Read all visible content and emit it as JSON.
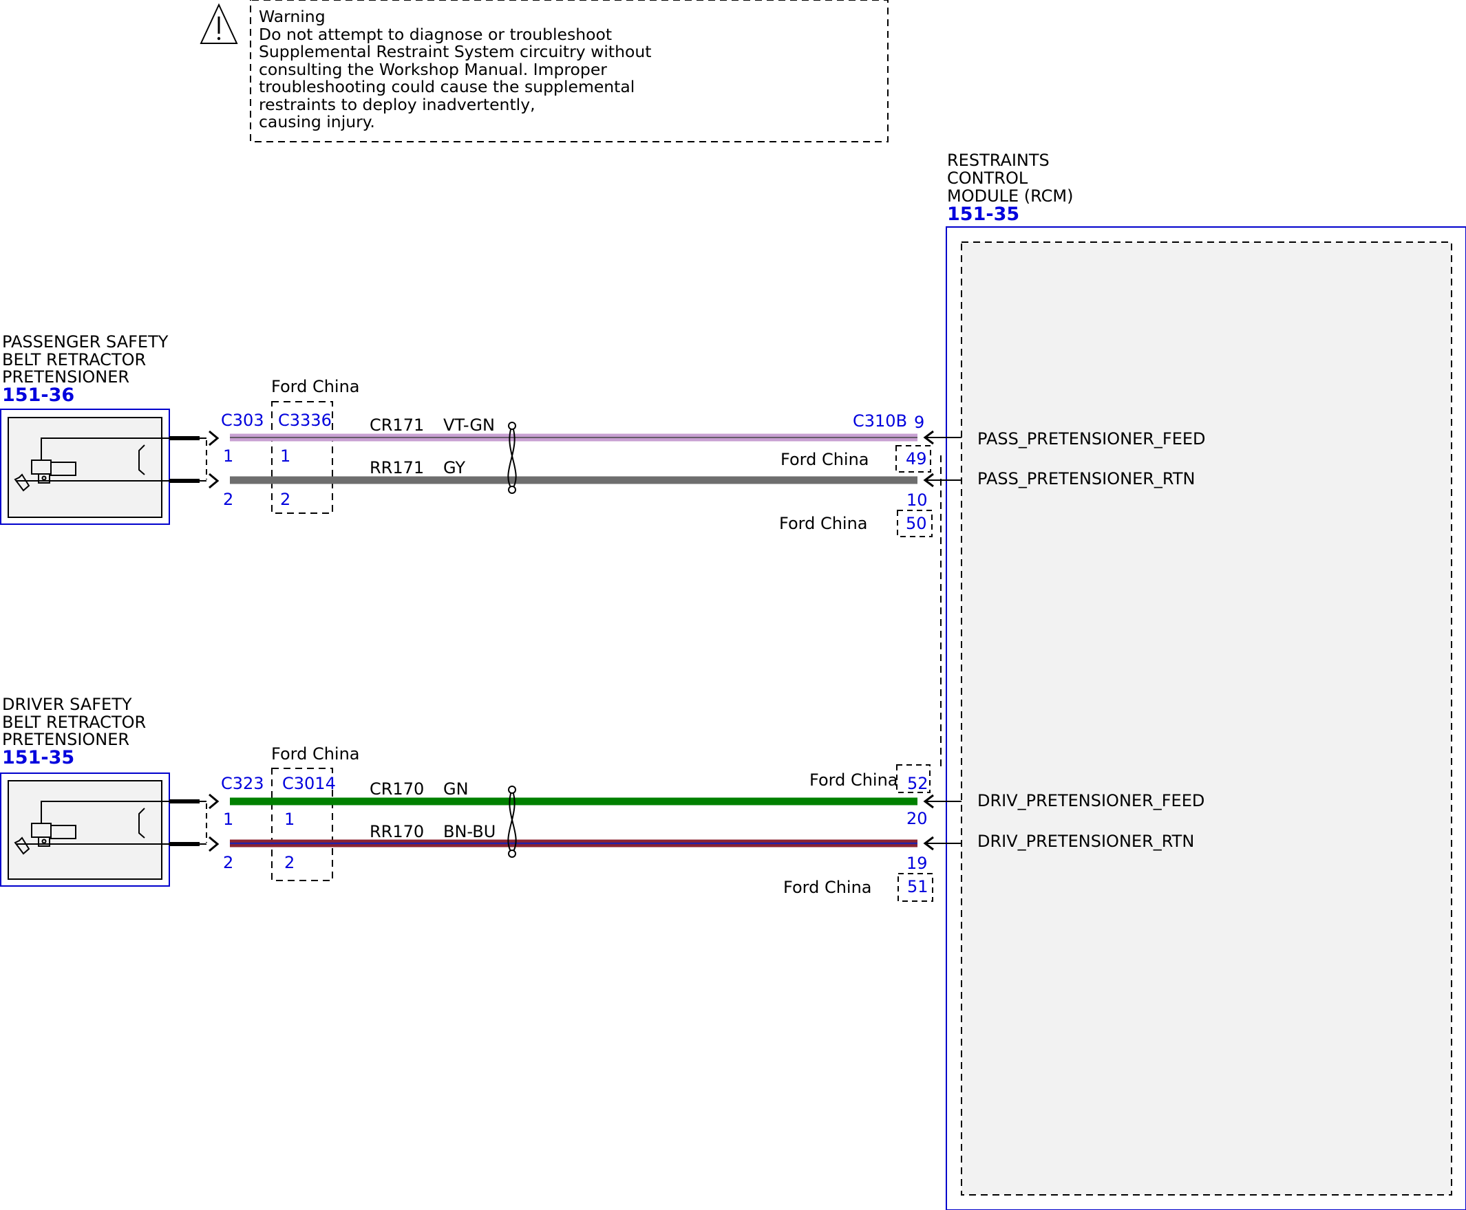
{
  "warning": {
    "title": "Warning",
    "lines": [
      "Do not attempt to diagnose or troubleshoot",
      "Supplemental Restraint System circuitry without",
      "consulting the Workshop Manual. Improper",
      "troubleshooting could cause the supplemental",
      "restraints to deploy inadvertently,",
      "causing injury."
    ]
  },
  "colors": {
    "outline_blue": "#0000cc",
    "label_blue": "#0000dd",
    "wire_vt_gn": "#c8a0d2",
    "wire_gy": "#6e6e6e",
    "wire_gn": "#008000",
    "wire_bn_bu": "#8b2330",
    "module_fill": "#f2f2f2"
  },
  "rcm": {
    "title_lines": [
      "RESTRAINTS",
      "CONTROL",
      "MODULE (RCM)"
    ],
    "ref": "151-35",
    "pins": [
      {
        "label": "PASS_PRETENSIONER_FEED"
      },
      {
        "label": "PASS_PRETENSIONER_RTN"
      },
      {
        "label": "DRIV_PRETENSIONER_FEED"
      },
      {
        "label": "DRIV_PRETENSIONER_RTN"
      }
    ]
  },
  "passenger": {
    "title_lines": [
      "PASSENGER SAFETY",
      "BELT RETRACTOR",
      "PRETENSIONER"
    ],
    "ref": "151-36",
    "connector": "C303",
    "inline_connector": "C3336",
    "inline_note": "Ford China",
    "pin1": "1",
    "pin2": "2",
    "inline_pin1": "1",
    "inline_pin2": "2",
    "wire1": {
      "circuit": "CR171",
      "color": "VT-GN"
    },
    "wire2": {
      "circuit": "RR171",
      "color": "GY"
    },
    "rcm_connector": "C310B",
    "rcm_pin_feed": "9",
    "rcm_pin_rtn": "10",
    "alt_note_1": "Ford China",
    "alt_pin_1": "49",
    "alt_note_2": "Ford China",
    "alt_pin_2": "50"
  },
  "driver": {
    "title_lines": [
      "DRIVER SAFETY",
      "BELT RETRACTOR",
      "PRETENSIONER"
    ],
    "ref": "151-35",
    "connector": "C323",
    "inline_connector": "C3014",
    "inline_note": "Ford China",
    "pin1": "1",
    "pin2": "2",
    "inline_pin1": "1",
    "inline_pin2": "2",
    "wire1": {
      "circuit": "CR170",
      "color": "GN"
    },
    "wire2": {
      "circuit": "RR170",
      "color": "BN-BU"
    },
    "rcm_pin_feed": "20",
    "rcm_pin_rtn": "19",
    "alt_note_1": "Ford China",
    "alt_pin_1": "52",
    "alt_note_2": "Ford China",
    "alt_pin_2": "51"
  }
}
